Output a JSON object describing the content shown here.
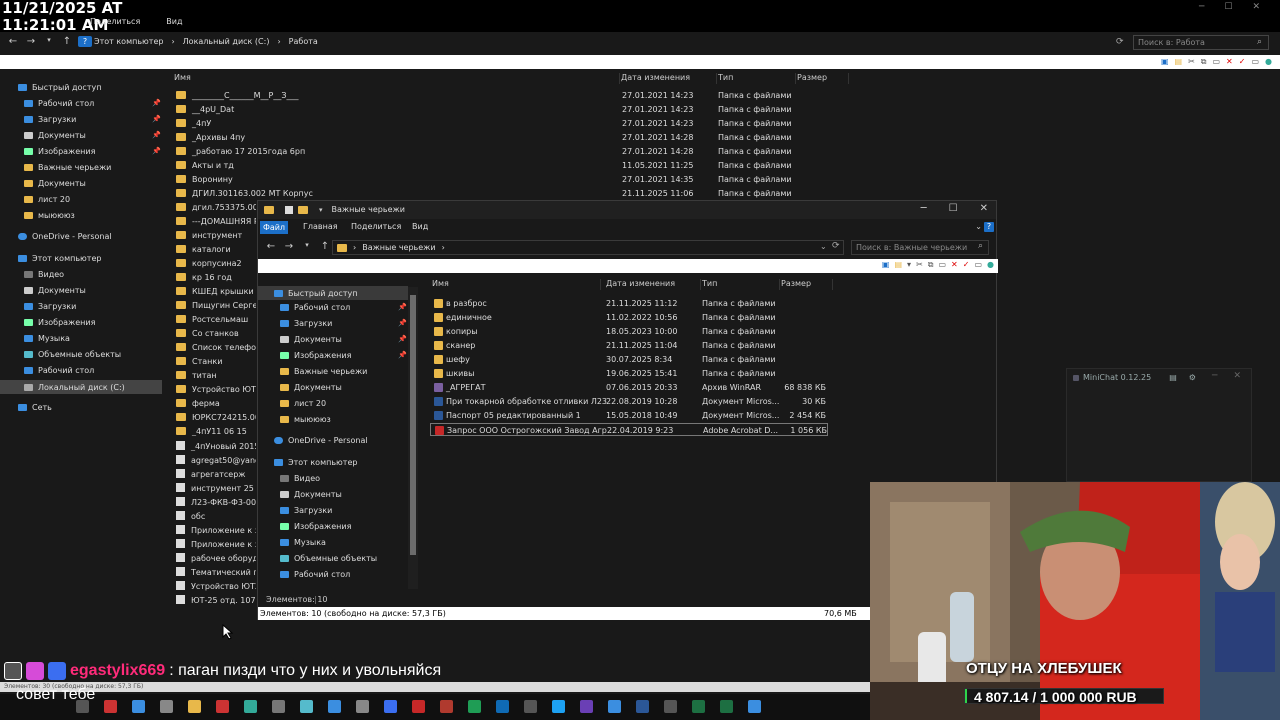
{
  "overlay": {
    "timestamp_line1": "11/21/2025 AT",
    "timestamp_line2": "11:21:01 AM"
  },
  "back_window": {
    "title_tabs": [
      "Поделиться",
      "Вид"
    ],
    "breadcrumbs": [
      "Этот компьютер",
      "Локальный диск (C:)",
      "Работа"
    ],
    "search_placeholder": "Поиск в: Работа",
    "columns": {
      "name": "Имя",
      "date": "Дата изменения",
      "type": "Тип",
      "size": "Размер"
    },
    "nav": [
      "Быстрый доступ",
      "Рабочий стол",
      "Загрузки",
      "Документы",
      "Изображения",
      "Важные черьежи",
      "Документы",
      "лист 20",
      "мыюююз",
      "OneDrive - Personal",
      "Этот компьютер",
      "Видео",
      "Документы",
      "Загрузки",
      "Изображения",
      "Музыка",
      "Объемные объекты",
      "Рабочий стол",
      "Локальный диск (C:)",
      "Сеть"
    ],
    "rows_full": [
      {
        "name": "________С______М__Р__З___",
        "date": "27.01.2021 14:23",
        "type": "Папка с файлами"
      },
      {
        "name": "__4pU_Dat",
        "date": "27.01.2021 14:23",
        "type": "Папка с файлами"
      },
      {
        "name": "_4пУ",
        "date": "27.01.2021 14:23",
        "type": "Папка с файлами"
      },
      {
        "name": "_Архивы 4пу",
        "date": "27.01.2021 14:28",
        "type": "Папка с файлами"
      },
      {
        "name": "_работаю 17 2015года 6рп",
        "date": "27.01.2021 14:28",
        "type": "Папка с файлами"
      },
      {
        "name": "Акты и тд",
        "date": "11.05.2021 11:25",
        "type": "Папка с файлами"
      },
      {
        "name": "Воронину",
        "date": "27.01.2021 14:35",
        "type": "Папка с файлами"
      },
      {
        "name": "ДГИЛ.301163.002 МТ Корпус",
        "date": "21.11.2025 11:06",
        "type": "Папка с файлами"
      }
    ],
    "rows_partial": [
      "дгил.753375.001 щ",
      "---ДОМАШНЯЯ РА",
      "инструмент",
      "каталоги",
      "корпусина2",
      "кр 16 год",
      "КШЕД крышки",
      "Пищугин Сергей В",
      "Ростсельмаш",
      "Со станков",
      "Список телефоно",
      "Станки",
      "титан",
      "Устройство ЮТ25-",
      "ферма",
      "ЮРКС724215.001 к",
      "_4пУ11 06 15",
      "_4пУновый 2015",
      "agregat50@yandex",
      "агрегатсерж",
      "инструмент 25 10 1",
      "Л23-ФКВ-Ф3-00.00",
      "обс",
      "Приложение к зап",
      "Приложение к зап",
      "рабочее оборудов",
      "Тематический пла",
      "Устройство ЮТ25",
      "ЮТ-25 отд. 107-8"
    ],
    "status": "Элементов: 30 (свободно на диске: 57,3 ГБ)"
  },
  "front_window": {
    "title": "Важные черьежи",
    "tabs": [
      "Файл",
      "Главная",
      "Поделиться",
      "Вид"
    ],
    "breadcrumb": "Важные черьежи",
    "search_placeholder": "Поиск в: Важные черьежи",
    "columns": {
      "name": "Имя",
      "date": "Дата изменения",
      "type": "Тип",
      "size": "Размер"
    },
    "nav": [
      "Быстрый доступ",
      "Рабочий стол",
      "Загрузки",
      "Документы",
      "Изображения",
      "Важные черьежи",
      "Документы",
      "лист 20",
      "мыюююз",
      "OneDrive - Personal",
      "Этот компьютер",
      "Видео",
      "Документы",
      "Загрузки",
      "Изображения",
      "Музыка",
      "Объемные объекты",
      "Рабочий стол"
    ],
    "rows": [
      {
        "name": "в разброс",
        "date": "21.11.2025 11:12",
        "type": "Папка с файлами",
        "size": "",
        "kind": "folder"
      },
      {
        "name": "единичное",
        "date": "11.02.2022 10:56",
        "type": "Папка с файлами",
        "size": "",
        "kind": "folder"
      },
      {
        "name": "копиры",
        "date": "18.05.2023 10:00",
        "type": "Папка с файлами",
        "size": "",
        "kind": "folder"
      },
      {
        "name": "сканер",
        "date": "21.11.2025 11:04",
        "type": "Папка с файлами",
        "size": "",
        "kind": "folder"
      },
      {
        "name": "шефу",
        "date": "30.07.2025 8:34",
        "type": "Папка с файлами",
        "size": "",
        "kind": "folder"
      },
      {
        "name": "шкивы",
        "date": "19.06.2025 15:41",
        "type": "Папка с файлами",
        "size": "",
        "kind": "folder"
      },
      {
        "name": "_АГРЕГАТ",
        "date": "07.06.2015 20:33",
        "type": "Архив WinRAR",
        "size": "68 838 КБ",
        "kind": "rar"
      },
      {
        "name": "При токарной обработке отливки Л23",
        "date": "22.08.2019 10:28",
        "type": "Документ Micros...",
        "size": "30 КБ",
        "kind": "doc"
      },
      {
        "name": "Паспорт 05 редактированный 1",
        "date": "15.05.2018 10:49",
        "type": "Документ Micros...",
        "size": "2 454 КБ",
        "kind": "doc"
      },
      {
        "name": "Запрос ООО Острогожский Завод Агр...",
        "date": "22.04.2019 9:23",
        "type": "Adobe Acrobat D...",
        "size": "1 056 КБ",
        "kind": "pdf"
      }
    ],
    "status_count": "Элементов: 10",
    "status_disk": "Элементов: 10 (свободно на диске: 57,3 ГБ)",
    "status_size": "70,6 МБ"
  },
  "minichat": {
    "title": "MiniChat 0.12.25"
  },
  "stream": {
    "chat_user": "egastylix669",
    "chat_message": ": паган пизди что у них и увольняйся",
    "advice": "совет тебе",
    "banner_title": "ОТЦУ НА ХЛЕБУШЕК",
    "banner_amount": "4 807.14 / 1 000 000 RUB"
  },
  "colors": {
    "folder": "#e8b84a",
    "accent": "#1c6fc8",
    "chat_name": "#ff2b7a",
    "pdf": "#c62828",
    "word": "#2b5797"
  }
}
